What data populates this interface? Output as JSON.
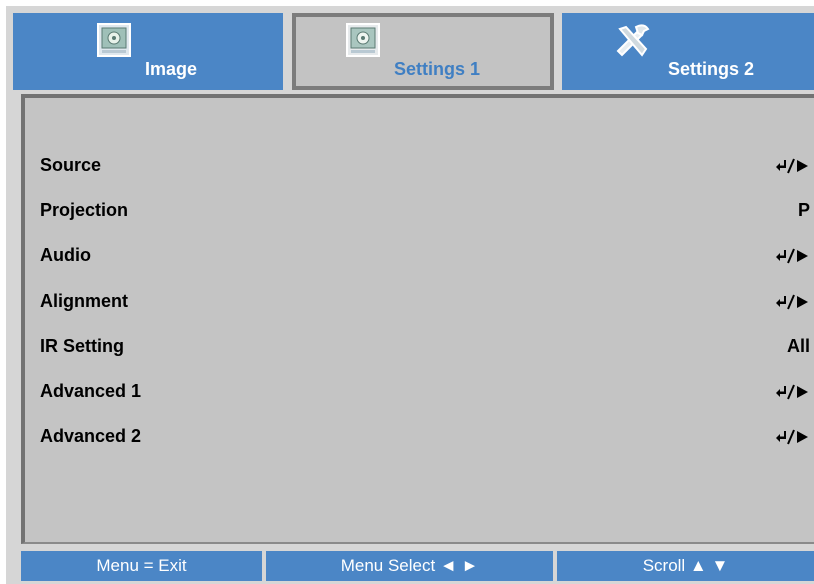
{
  "tabs": [
    {
      "label": "Image",
      "icon": "image-icon",
      "active": false
    },
    {
      "label": "Settings 1",
      "icon": "settings-icon",
      "active": true
    },
    {
      "label": "Settings 2",
      "icon": "tools-icon",
      "active": false
    }
  ],
  "menu": {
    "items": [
      {
        "label": "Source",
        "value": "",
        "action": "enter-arrow-icon"
      },
      {
        "label": "Projection",
        "value": "P"
      },
      {
        "label": "Audio",
        "value": "",
        "action": "enter-arrow-icon"
      },
      {
        "label": "Alignment",
        "value": "",
        "action": "enter-arrow-icon"
      },
      {
        "label": "IR Setting",
        "value": "All"
      },
      {
        "label": "Advanced 1",
        "value": "",
        "action": "enter-arrow-icon"
      },
      {
        "label": "Advanced 2",
        "value": "",
        "action": "enter-arrow-icon"
      }
    ]
  },
  "footer": {
    "exit": "Menu = Exit",
    "select": "Menu Select ◄ ►",
    "scroll": "Scroll ▲ ▼"
  },
  "colors": {
    "tab_blue": "#4b86c6",
    "active_label": "#3f7fc3",
    "panel": "#c4c4c4"
  }
}
